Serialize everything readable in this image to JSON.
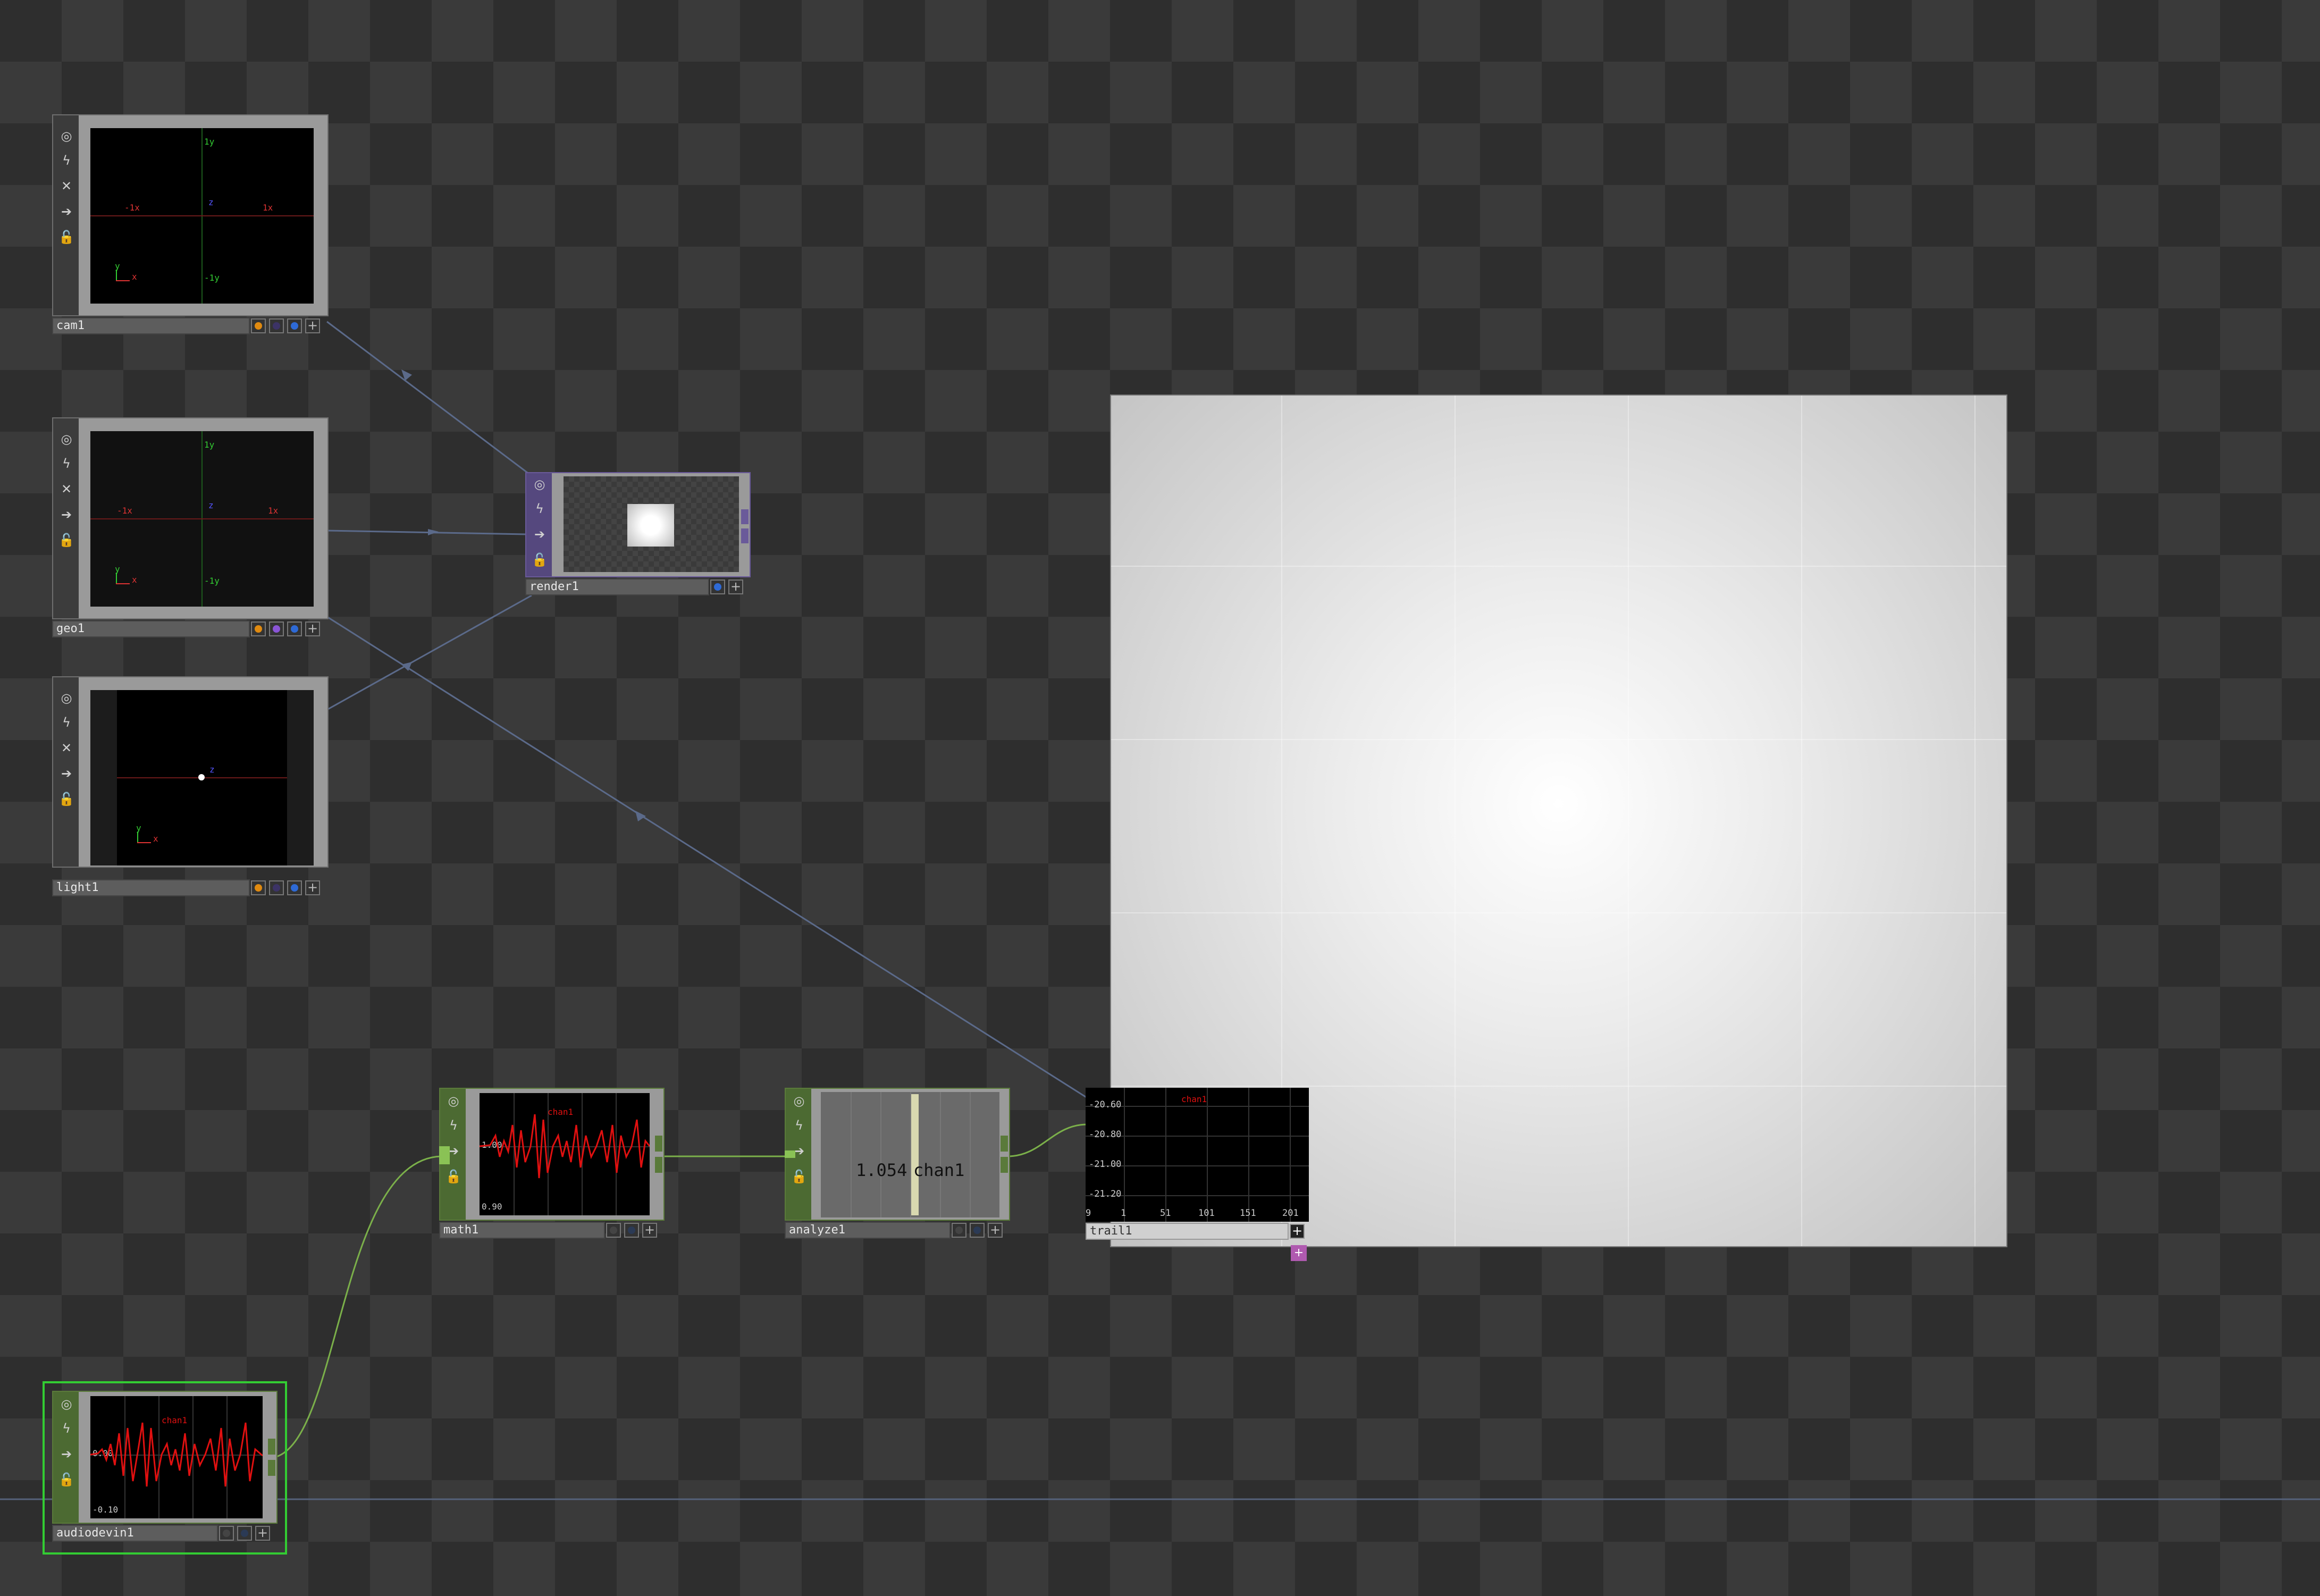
{
  "colors": {
    "wire_blue": "#5b6a8a",
    "wire_green": "#7bb04a",
    "waveform": "#e01010",
    "selected": "#33cc33"
  },
  "nodes": {
    "cam1": {
      "name": "cam1",
      "labels": {
        "y_pos": "1y",
        "y_neg": "-1y",
        "x_pos": "1x",
        "x_neg": "-1x",
        "z": "z",
        "gx": "x",
        "gy": "y"
      }
    },
    "geo1": {
      "name": "geo1",
      "labels": {
        "y_pos": "1y",
        "y_neg": "-1y",
        "x_pos": "1x",
        "x_neg": "-1x",
        "z": "z",
        "gx": "x",
        "gy": "y"
      }
    },
    "light1": {
      "name": "light1",
      "labels": {
        "z": "z",
        "gx": "x",
        "gy": "y"
      }
    },
    "render1": {
      "name": "render1"
    },
    "math1": {
      "name": "math1",
      "channel": "chan1",
      "v_top": "1.00",
      "v_bottom": "0.90"
    },
    "analyze1": {
      "name": "analyze1",
      "value": "1.054",
      "channel": "chan1"
    },
    "trail1": {
      "name": "trail1",
      "channel": "chan1",
      "y_ticks": [
        "-20.60",
        "-20.80",
        "-21.00",
        "-21.20"
      ],
      "x_ticks": [
        "9",
        "1",
        "51",
        "101",
        "151",
        "201"
      ]
    },
    "audiodevin1": {
      "name": "audiodevin1",
      "channel": "chan1",
      "v_top": "0.00",
      "v_bottom": "-0.10"
    }
  },
  "icons": {
    "viewer": "target-icon",
    "bypass": "lightning-icon",
    "close": "x-icon",
    "cook": "arrow-right-icon",
    "lock": "lock-icon"
  }
}
